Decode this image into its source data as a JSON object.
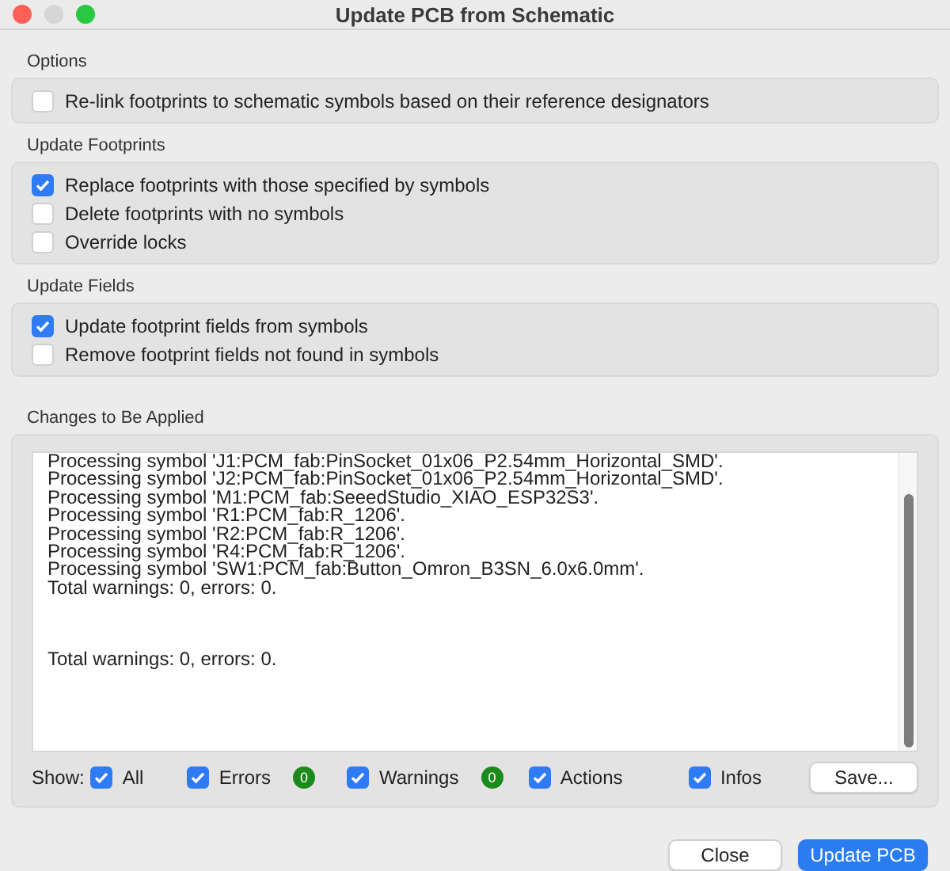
{
  "window": {
    "title": "Update PCB from Schematic"
  },
  "groups": [
    {
      "title": "Options",
      "options": [
        {
          "label": "Re-link footprints to schematic symbols based on their reference designators",
          "checked": false
        }
      ]
    },
    {
      "title": "Update Footprints",
      "options": [
        {
          "label": "Replace footprints with those specified by symbols",
          "checked": true
        },
        {
          "label": "Delete footprints with no symbols",
          "checked": false
        },
        {
          "label": "Override locks",
          "checked": false
        }
      ]
    },
    {
      "title": "Update Fields",
      "options": [
        {
          "label": "Update footprint fields from symbols",
          "checked": true
        },
        {
          "label": "Remove footprint fields not found in symbols",
          "checked": false
        }
      ]
    }
  ],
  "changes": {
    "title": "Changes to Be Applied",
    "log_blocks": [
      {
        "lines": [
          "Processing symbol 'J1:PCM_fab:PinSocket_01x06_P2.54mm_Horizontal_SMD'.",
          "Processing symbol 'J2:PCM_fab:PinSocket_01x06_P2.54mm_Horizontal_SMD'.",
          "Processing symbol 'M1:PCM_fab:SeeedStudio_XIAO_ESP32S3'.",
          "Processing symbol 'R1:PCM_fab:R_1206'.",
          "Processing symbol 'R2:PCM_fab:R_1206'.",
          "Processing symbol 'R4:PCM_fab:R_1206'.",
          "Processing symbol 'SW1:PCM_fab:Button_Omron_B3SN_6.0x6.0mm'.",
          "Total warnings: 0, errors: 0."
        ]
      },
      {
        "lines": [
          "Total warnings: 0, errors: 0."
        ]
      }
    ],
    "show_label": "Show:",
    "filters": [
      {
        "label": "All",
        "checked": true
      },
      {
        "label": "Errors",
        "checked": true,
        "count": "0",
        "color": "#1a8a1a"
      },
      {
        "label": "Warnings",
        "checked": true,
        "count": "0",
        "color": "#1a8a1a"
      },
      {
        "label": "Actions",
        "checked": true
      },
      {
        "label": "Infos",
        "checked": true
      }
    ],
    "save_button": "Save..."
  },
  "buttons": [
    {
      "label": "Close",
      "kind": "default"
    },
    {
      "label": "Update PCB",
      "kind": "primary"
    }
  ]
}
